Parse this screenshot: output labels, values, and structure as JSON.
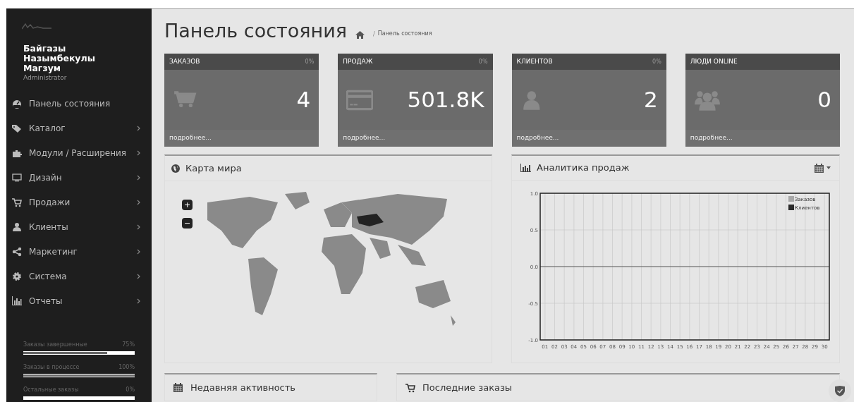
{
  "sidebar": {
    "user": {
      "name": "Байгазы Назымбекулы Магзум",
      "role": "Administrator"
    },
    "items": [
      {
        "label": "Панель состояния",
        "kind": "dashboard",
        "has_submenu": false
      },
      {
        "label": "Каталог",
        "kind": "tags",
        "has_submenu": true
      },
      {
        "label": "Модули / Расширения",
        "kind": "puzzle",
        "has_submenu": true
      },
      {
        "label": "Дизайн",
        "kind": "monitor",
        "has_submenu": true
      },
      {
        "label": "Продажи",
        "kind": "cart",
        "has_submenu": true
      },
      {
        "label": "Клиенты",
        "kind": "user",
        "has_submenu": true
      },
      {
        "label": "Маркетинг",
        "kind": "share",
        "has_submenu": true
      },
      {
        "label": "Система",
        "kind": "gear",
        "has_submenu": true
      },
      {
        "label": "Отчеты",
        "kind": "chart",
        "has_submenu": true
      }
    ],
    "stats": [
      {
        "label": "Заказы завершенные",
        "reading": "75%",
        "level": 0.75
      },
      {
        "label": "Заказы в процессе",
        "reading": "100%",
        "level": 1
      },
      {
        "label": "Остальные заказы",
        "reading": "0%",
        "level": 0
      }
    ]
  },
  "header": {
    "title": "Панель состояния",
    "separator": "/",
    "breadcrumb": "Панель состояния"
  },
  "tiles": [
    {
      "title": "ЗАКАЗОВ",
      "percent": "0%",
      "value": "4",
      "kind": "cart",
      "link": "подробнее..."
    },
    {
      "title": "ПРОДАЖ",
      "percent": "0%",
      "value": "501.8K",
      "kind": "card",
      "link": "подробнее..."
    },
    {
      "title": "КЛИЕНТОВ",
      "percent": "0%",
      "value": "2",
      "kind": "user",
      "link": "подробнее..."
    },
    {
      "title": "ЛЮДИ ONLINE",
      "value": "0",
      "kind": "users",
      "link": "подробнее..."
    }
  ],
  "map_panel": {
    "title": "Карта мира",
    "zoom_in": "+",
    "zoom_out": "−"
  },
  "sales_panel": {
    "title": "Аналитика продаж",
    "chart_data": {
      "type": "line",
      "categories": [
        "01",
        "02",
        "03",
        "04",
        "05",
        "06",
        "07",
        "08",
        "09",
        "10",
        "11",
        "12",
        "13",
        "14",
        "15",
        "16",
        "17",
        "18",
        "19",
        "20",
        "21",
        "22",
        "23",
        "24",
        "25",
        "26",
        "27",
        "28",
        "29",
        "30"
      ],
      "series": [
        {
          "name": "Заказов",
          "color": "#a8a8a8",
          "values": [
            null,
            null,
            null,
            null,
            null,
            null,
            null,
            null,
            null,
            null,
            null,
            null,
            null,
            null,
            null,
            null,
            null,
            null,
            null,
            null,
            null,
            null,
            null,
            null,
            null,
            null,
            null,
            null,
            null,
            null
          ]
        },
        {
          "name": "Клиентов",
          "color": "#2a2a2a",
          "values": [
            null,
            null,
            null,
            null,
            null,
            null,
            null,
            null,
            null,
            null,
            null,
            null,
            null,
            null,
            null,
            null,
            null,
            null,
            null,
            null,
            null,
            null,
            null,
            null,
            null,
            null,
            null,
            null,
            null,
            null
          ]
        }
      ],
      "ylim": [
        -1,
        1
      ],
      "yticks": [
        {
          "value": -1,
          "label": "-1.0"
        },
        {
          "value": -0.5,
          "label": "-0.5"
        },
        {
          "value": 0,
          "label": "0.0"
        },
        {
          "value": 0.5,
          "label": "0.5"
        },
        {
          "value": 1,
          "label": "1.0"
        }
      ],
      "grid": true,
      "legend": true
    }
  },
  "bottom_panels": [
    {
      "title": "Недавняя активность",
      "kind": "calendar"
    },
    {
      "title": "Последние заказы",
      "kind": "cart"
    }
  ]
}
